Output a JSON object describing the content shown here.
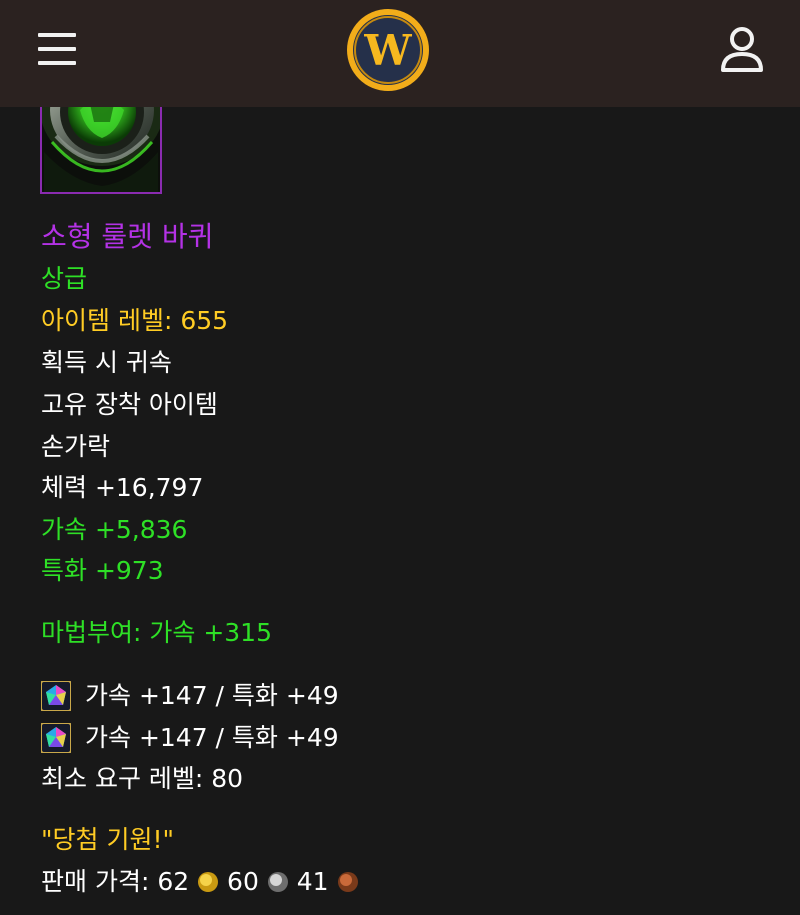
{
  "header": {
    "menu_icon": "hamburger-menu-icon",
    "logo_letter": "W",
    "user_icon": "user-profile-icon",
    "background": "#2b2220",
    "logo_color": "#f5b21d"
  },
  "item": {
    "icon_name": "green-ring-icon",
    "name": "소형 룰렛 바퀴",
    "quality": "상급",
    "item_level": "아이템 레벨: 655",
    "binding": "획득 시 귀속",
    "unique": "고유 장착 아이템",
    "slot": "손가락",
    "stamina": "체력 +16,797",
    "haste": "가속 +5,836",
    "mastery": "특화 +973",
    "enchant": "마법부여: 가속 +315",
    "gems": [
      {
        "icon": "prismatic-gem-icon",
        "text": "가속 +147 / 특화 +49"
      },
      {
        "icon": "prismatic-gem-icon",
        "text": "가속 +147 / 특화 +49"
      }
    ],
    "required_level": "최소 요구 레벨: 80",
    "flavor": "\"당첨 기원!\"",
    "sell_price": {
      "label": "판매 가격:",
      "gold": "62",
      "silver": "60",
      "copper": "41"
    }
  },
  "colors": {
    "epic_purple": "#b432e6",
    "stat_green": "#2ee026",
    "gold_yellow": "#ffcc24",
    "text_white": "#ffffff",
    "background": "#181818"
  }
}
